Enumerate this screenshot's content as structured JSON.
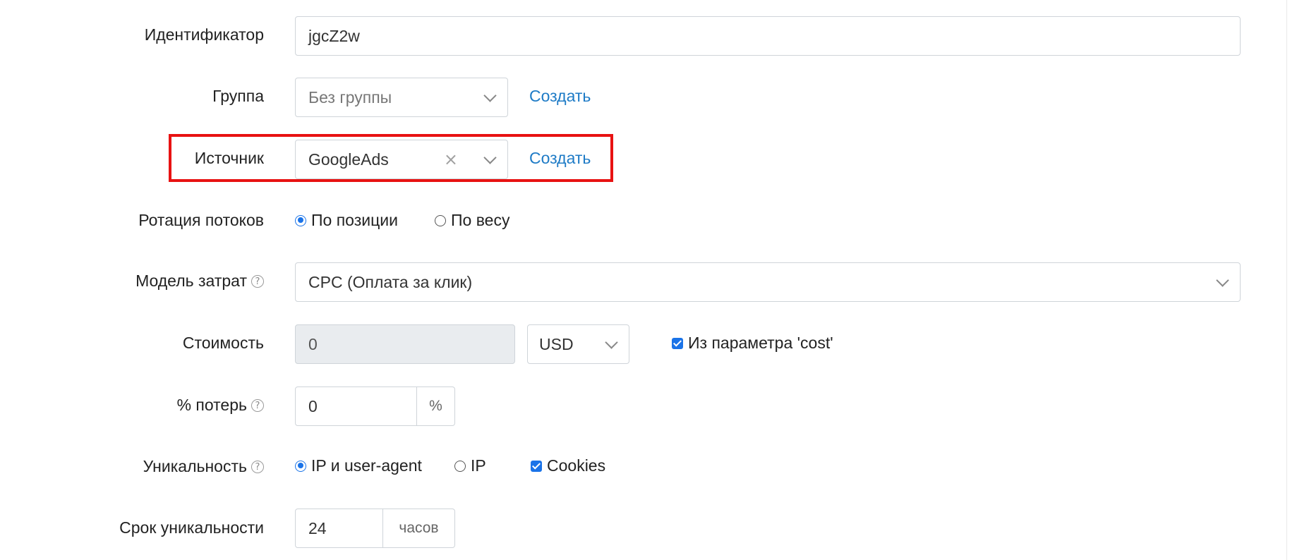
{
  "form": {
    "identifier": {
      "label": "Идентификатор",
      "value": "jgcZ2w"
    },
    "group": {
      "label": "Группа",
      "placeholder": "Без группы",
      "create_link": "Создать"
    },
    "source": {
      "label": "Источник",
      "value": "GoogleAds",
      "clear_icon": "×",
      "create_link": "Создать"
    },
    "rotation": {
      "label": "Ротация потоков",
      "options": [
        {
          "label": "По позиции",
          "selected": true
        },
        {
          "label": "По весу",
          "selected": false
        }
      ]
    },
    "cost_model": {
      "label": "Модель затрат",
      "value": "CPC (Оплата за клик)"
    },
    "cost": {
      "label": "Стоимость",
      "value": "0",
      "currency": "USD",
      "from_param_label": "Из параметра 'cost'",
      "from_param_checked": true
    },
    "loss": {
      "label": "% потерь",
      "value": "0",
      "unit": "%"
    },
    "uniqueness": {
      "label": "Уникальность",
      "options": [
        {
          "label": "IP и user-agent",
          "selected": true
        },
        {
          "label": "IP",
          "selected": false
        }
      ],
      "cookies_label": "Cookies",
      "cookies_checked": true
    },
    "uniqueness_ttl": {
      "label": "Срок уникальности",
      "value": "24",
      "unit": "часов"
    }
  },
  "icons": {
    "help": "?",
    "accent_color": "#1e7bc6",
    "highlight_color": "#e81212"
  }
}
